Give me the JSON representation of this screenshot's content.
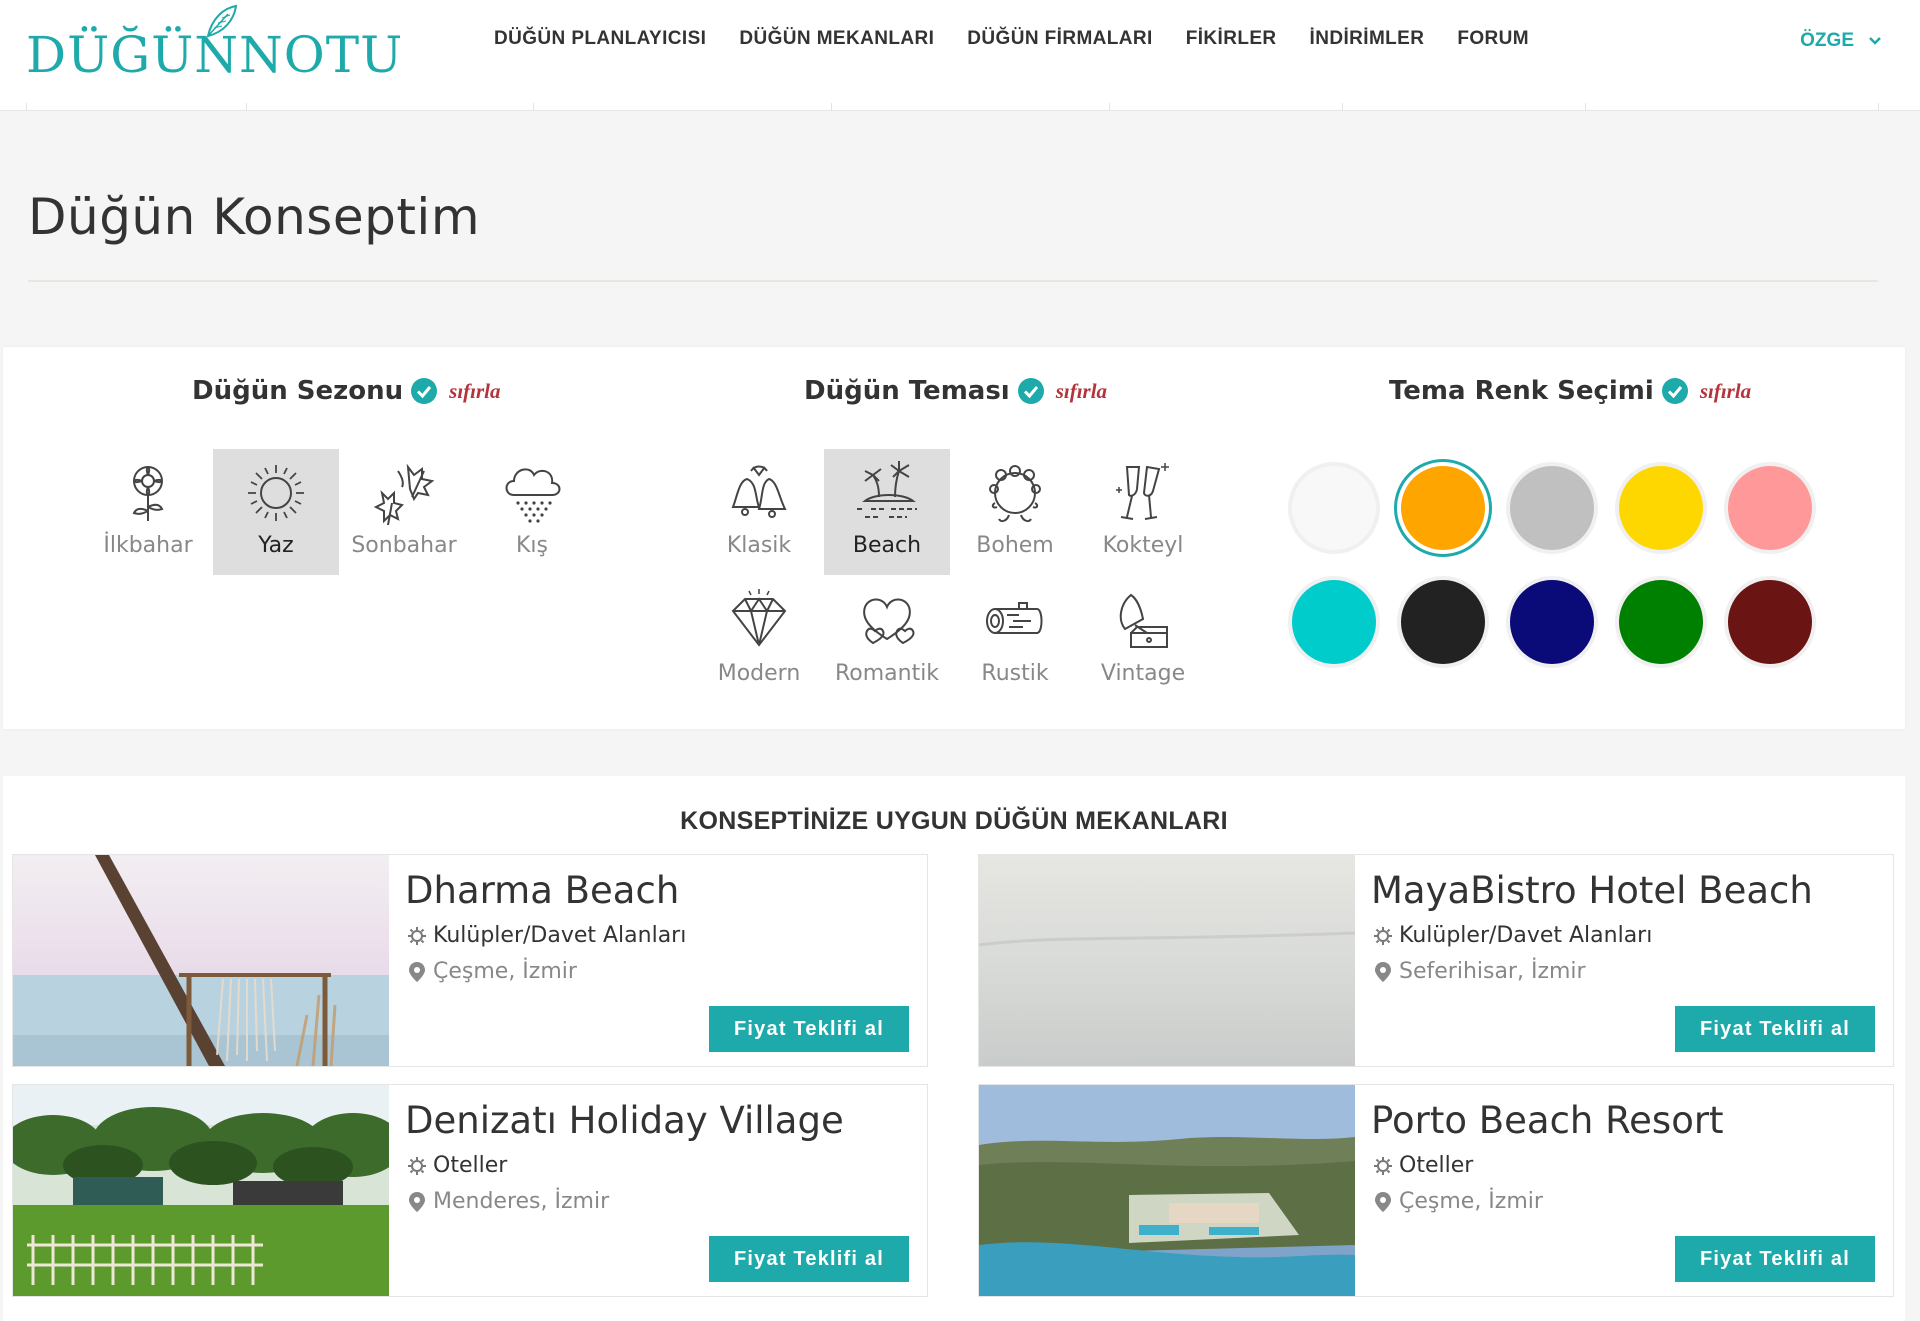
{
  "header": {
    "logo_text": "DÜĞÜNNOTU",
    "nav": [
      "DÜĞÜN PLANLAYICISI",
      "DÜĞÜN MEKANLARI",
      "DÜĞÜN FİRMALARI",
      "FİKİRLER",
      "İNDİRİMLER",
      "FORUM"
    ],
    "user_name": "ÖZGE"
  },
  "page_title": "Düğün Konseptim",
  "season": {
    "heading": "Düğün Sezonu",
    "reset_label": "sıfırla",
    "options": [
      {
        "label": "İlkbahar",
        "icon": "flower-icon",
        "selected": false
      },
      {
        "label": "Yaz",
        "icon": "sun-icon",
        "selected": true
      },
      {
        "label": "Sonbahar",
        "icon": "autumn-leaves-icon",
        "selected": false
      },
      {
        "label": "Kış",
        "icon": "snow-cloud-icon",
        "selected": false
      }
    ]
  },
  "theme": {
    "heading": "Düğün Teması",
    "reset_label": "sıfırla",
    "options": [
      {
        "label": "Klasik",
        "icon": "wedding-bells-icon",
        "selected": false
      },
      {
        "label": "Beach",
        "icon": "palm-island-icon",
        "selected": true
      },
      {
        "label": "Bohem",
        "icon": "flower-wreath-icon",
        "selected": false
      },
      {
        "label": "Kokteyl",
        "icon": "champagne-glasses-icon",
        "selected": false
      },
      {
        "label": "Modern",
        "icon": "diamond-icon",
        "selected": false
      },
      {
        "label": "Romantik",
        "icon": "hearts-icon",
        "selected": false
      },
      {
        "label": "Rustik",
        "icon": "log-icon",
        "selected": false
      },
      {
        "label": "Vintage",
        "icon": "gramophone-icon",
        "selected": false
      }
    ]
  },
  "colors": {
    "heading": "Tema Renk Seçimi",
    "reset_label": "sıfırla",
    "swatches": [
      {
        "hex": "#f8f8f8",
        "selected": false
      },
      {
        "hex": "#ffa500",
        "selected": true
      },
      {
        "hex": "#c0c0c0",
        "selected": false
      },
      {
        "hex": "#ffd700",
        "selected": false
      },
      {
        "hex": "#ff9999",
        "selected": false
      },
      {
        "hex": "#00cccc",
        "selected": false
      },
      {
        "hex": "#222222",
        "selected": false
      },
      {
        "hex": "#0a0a78",
        "selected": false
      },
      {
        "hex": "#008000",
        "selected": false
      },
      {
        "hex": "#6b1414",
        "selected": false
      }
    ]
  },
  "venues": {
    "heading": "KONSEPTİNİZE UYGUN DÜĞÜN MEKANLARI",
    "button_label": "Fiyat Teklifi al",
    "items": [
      {
        "name": "Dharma Beach",
        "category": "Kulüpler/Davet Alanları",
        "location": "Çeşme, İzmir"
      },
      {
        "name": "MayaBistro Hotel Beach",
        "category": "Kulüpler/Davet Alanları",
        "location": "Seferihisar, İzmir"
      },
      {
        "name": "Denizatı Holiday Village",
        "category": "Oteller",
        "location": "Menderes, İzmir"
      },
      {
        "name": "Porto Beach Resort",
        "category": "Oteller",
        "location": "Çeşme, İzmir"
      }
    ]
  },
  "accent_color": "#1eaaab",
  "reset_color": "#b5333a"
}
